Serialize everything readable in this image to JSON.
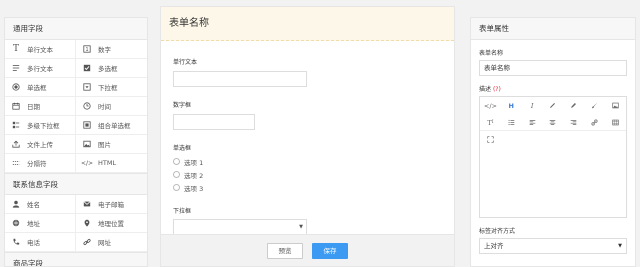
{
  "left": {
    "sections": [
      {
        "title": "通用字段",
        "items": [
          {
            "label": "单行文本",
            "icon": "T",
            "name": "text-icon"
          },
          {
            "label": "数字",
            "icon": "#",
            "name": "number-icon"
          },
          {
            "label": "多行文本",
            "icon": "≡",
            "name": "textarea-icon"
          },
          {
            "label": "多选框",
            "icon": "☑",
            "name": "checkbox-icon"
          },
          {
            "label": "单选框",
            "icon": "◉",
            "name": "radio-icon"
          },
          {
            "label": "下拉框",
            "icon": "▾",
            "name": "dropdown-icon"
          },
          {
            "label": "日期",
            "icon": "▦",
            "name": "calendar-icon"
          },
          {
            "label": "时间",
            "icon": "◷",
            "name": "clock-icon"
          },
          {
            "label": "多级下拉框",
            "icon": "☰",
            "name": "cascade-icon"
          },
          {
            "label": "组合单选框",
            "icon": "▣",
            "name": "combo-radio-icon"
          },
          {
            "label": "文件上传",
            "icon": "⇪",
            "name": "upload-icon"
          },
          {
            "label": "图片",
            "icon": "▨",
            "name": "image-icon"
          },
          {
            "label": "分隔符",
            "icon": "⁞",
            "name": "divider-icon"
          },
          {
            "label": "HTML",
            "icon": "</>",
            "name": "code-icon"
          }
        ]
      },
      {
        "title": "联系信息字段",
        "items": [
          {
            "label": "姓名",
            "icon": "●",
            "name": "user-icon"
          },
          {
            "label": "电子邮箱",
            "icon": "✉",
            "name": "email-icon"
          },
          {
            "label": "地址",
            "icon": "◍",
            "name": "address-icon"
          },
          {
            "label": "地理位置",
            "icon": "⚲",
            "name": "location-icon"
          },
          {
            "label": "电话",
            "icon": "✆",
            "name": "phone-icon"
          },
          {
            "label": "网址",
            "icon": "⛓",
            "name": "link-icon"
          }
        ]
      },
      {
        "title": "商品字段",
        "items": []
      }
    ]
  },
  "center": {
    "form_title": "表单名称",
    "fields": {
      "single_text": "单行文本",
      "number": "数字框",
      "radio": "单选框",
      "radio_options": [
        "选项 1",
        "选项 2",
        "选项 3"
      ],
      "dropdown": "下拉框"
    },
    "preview_label": "预览",
    "save_label": "保存"
  },
  "right": {
    "title": "表单属性",
    "name_label": "表单名称",
    "name_value": "表单名称",
    "desc_label": "描述",
    "desc_optional": "(?)",
    "align_label": "标签对齐方式",
    "align_value": "上对齐"
  }
}
